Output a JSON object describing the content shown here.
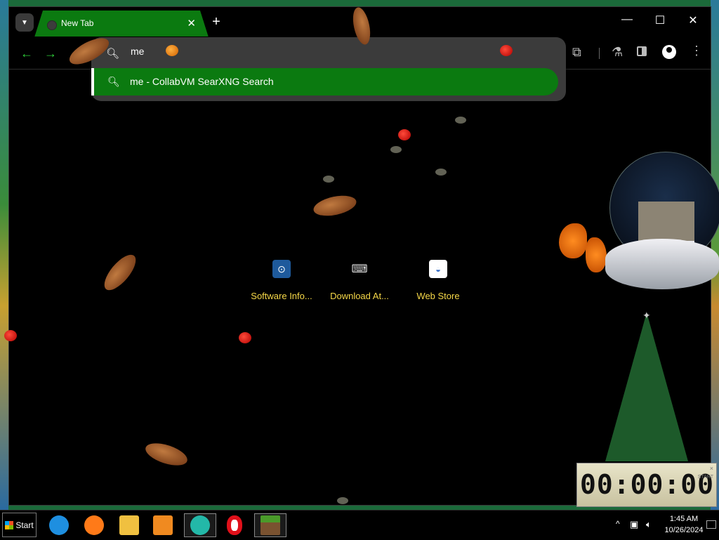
{
  "browser": {
    "tab": {
      "title": "New Tab",
      "close": "✕"
    },
    "new_tab": "+",
    "window_controls": {
      "minimize": "—",
      "maximize": "☐",
      "close": "✕"
    },
    "toolbar": {
      "back": "←",
      "forward": "→",
      "extensions": "⧉",
      "labs": "⚗",
      "menu": "⋮"
    },
    "omnibox": {
      "value": "me",
      "suggestion": "me - CollabVM SearXNG Search",
      "search_glyph": "🔍︎"
    },
    "shortcuts": [
      {
        "label": "Software Info...",
        "icon": "search-icon",
        "color": "#1e5a9c"
      },
      {
        "label": "Download At...",
        "icon": "keyboard-icon",
        "color": "#444444"
      },
      {
        "label": "Web Store",
        "icon": "store-icon",
        "color": "#3a70c8"
      }
    ],
    "accent": "#0b7a10",
    "shortcut_label_color": "#f6d848"
  },
  "desktop_widgets": {
    "timer": {
      "display": "00:00:00",
      "start": "START",
      "close": "×"
    }
  },
  "taskbar": {
    "start_label": "Start",
    "apps": [
      {
        "name": "internet-explorer-icon",
        "color": "#1e8fe0"
      },
      {
        "name": "firefox-icon",
        "color": "#ff7a18"
      },
      {
        "name": "file-explorer-icon",
        "color": "#f0c040"
      },
      {
        "name": "media-player-icon",
        "color": "#f08a20"
      },
      {
        "name": "collabvm-icon",
        "color": "#23b8a8"
      },
      {
        "name": "opera-icon",
        "color": "#e0101a"
      },
      {
        "name": "minecraft-icon",
        "color": "#5a8a2a"
      }
    ],
    "tray": {
      "show_hidden": "^",
      "network": "▣",
      "volume": "🔈︎"
    },
    "clock": {
      "time": "1:45 AM",
      "date": "10/26/2024"
    }
  }
}
